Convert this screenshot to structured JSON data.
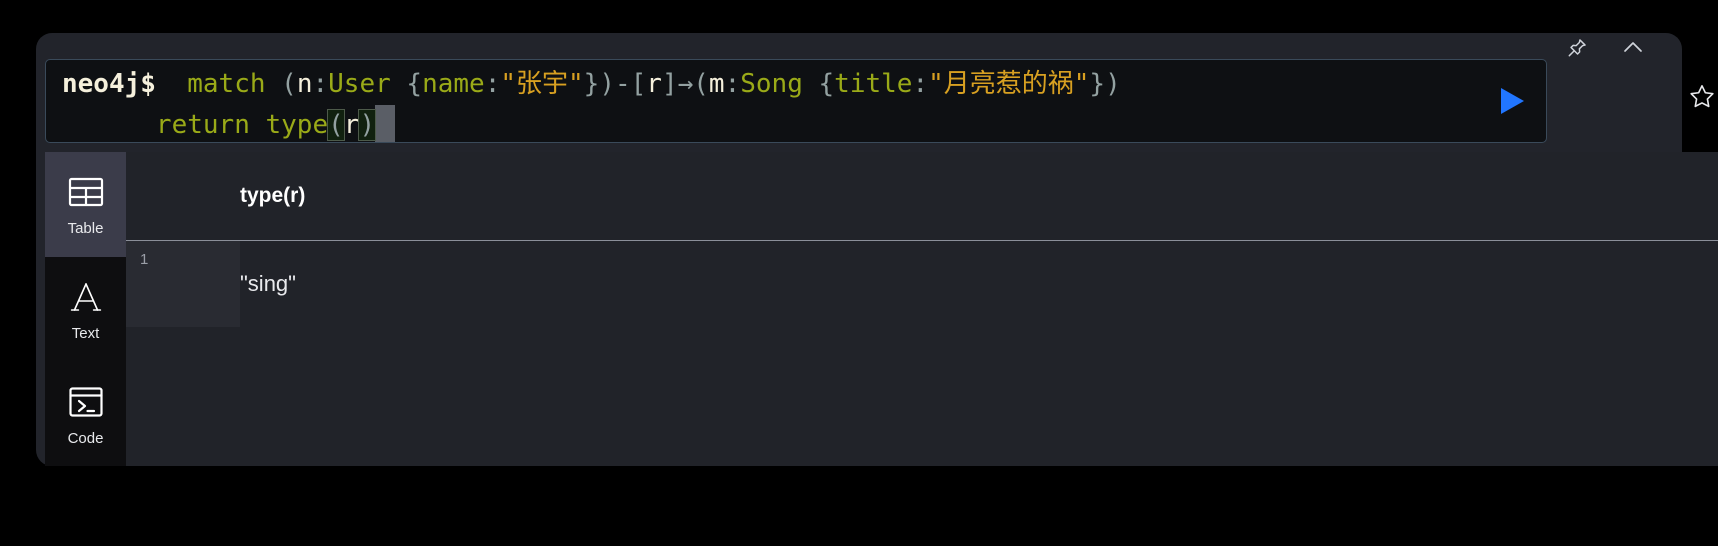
{
  "app": {
    "name": "neo4j-browser-query-card",
    "theme": "dark",
    "accent_color": "#2176ff",
    "frame_bg": "#22242b",
    "editor_bg": "#0e1013",
    "results_bg": "#212329",
    "sidebar_bg": "#0e0e10",
    "sidebar_active_bg": "#3b3c4a"
  },
  "window_controls": {
    "pin": {
      "icon": "pin-icon",
      "title": "Pin"
    },
    "collapse": {
      "icon": "chevron-up-icon",
      "title": "Collapse"
    }
  },
  "editor": {
    "prompt": "neo4j$",
    "line1": {
      "kw_match": "match",
      "paren_open": "(",
      "var_n": "n",
      "colon1": ":",
      "label_user": "User",
      "brace_open": " {",
      "key_name": "name",
      "colon2": ":",
      "str_name": "\"张宇\"",
      "brace_close": "}",
      "paren_close": ")",
      "rel": "-[",
      "var_r": "r",
      "rel_close": "]",
      "arrow": "→",
      "paren_open2": "(",
      "var_m": "m",
      "colon3": ":",
      "label_song": "Song",
      "brace_open2": " {",
      "key_title": "title",
      "colon4": ":",
      "str_title": "\"月亮惹的祸\"",
      "brace_close2": "}",
      "paren_close2": ")"
    },
    "line2": {
      "indent": "      ",
      "kw_return": "return",
      "fn_type": "type",
      "bracket_open": "(",
      "var_r": "r",
      "bracket_close": ")"
    },
    "full_query": "match (n:User {name:\"张宇\"})-[r]→(m:Song {title:\"月亮惹的祸\"})\n      return type(r)",
    "run_button_label": "Run",
    "run_icon": "play-icon"
  },
  "favorite": {
    "icon": "star-icon",
    "title": "Favorite"
  },
  "view_switcher": {
    "items": [
      {
        "id": "table",
        "label": "Table",
        "icon": "table-icon",
        "active": true
      },
      {
        "id": "text",
        "label": "Text",
        "icon": "text-a-icon",
        "active": false
      },
      {
        "id": "code",
        "label": "Code",
        "icon": "code-terminal-icon",
        "active": false
      }
    ]
  },
  "results": {
    "columns": [
      "type(r)"
    ],
    "rows": [
      {
        "index": "1",
        "values": [
          "\"sing\""
        ]
      }
    ]
  }
}
